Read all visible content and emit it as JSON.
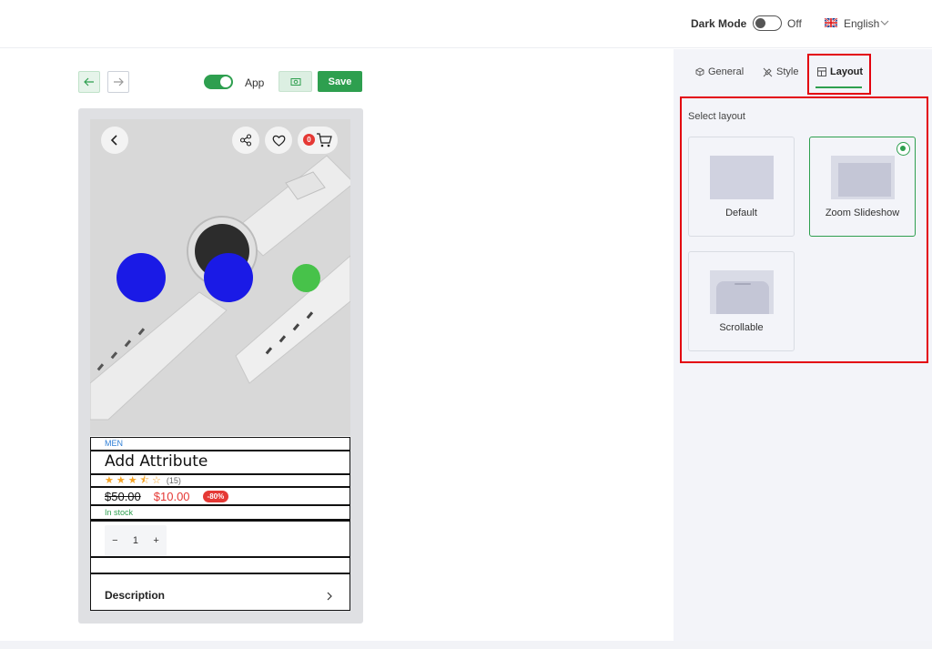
{
  "header": {
    "dark_mode_label": "Dark Mode",
    "dark_mode_state": "Off",
    "language": "English"
  },
  "toolbar": {
    "app_label": "App",
    "save_label": "Save"
  },
  "product": {
    "category": "MEN",
    "title": "Add Attribute",
    "rating_count": "(15)",
    "rating": 3.5,
    "old_price": "$50.00",
    "new_price": "$10.00",
    "discount": "-80%",
    "stock": "In stock",
    "qty_minus": "−",
    "qty_value": "1",
    "qty_plus": "+",
    "description_label": "Description",
    "cart_count": "0"
  },
  "panel": {
    "tabs": [
      {
        "label": "General",
        "icon": "cube-icon"
      },
      {
        "label": "Style",
        "icon": "brush-icon"
      },
      {
        "label": "Layout",
        "icon": "layout-icon"
      }
    ],
    "active_tab": "Layout",
    "section_title": "Select layout",
    "layouts": [
      {
        "label": "Default",
        "selected": false
      },
      {
        "label": "Zoom Slideshow",
        "selected": true
      },
      {
        "label": "Scrollable",
        "selected": false
      }
    ]
  },
  "colors": {
    "accent": "#2e9f4f",
    "highlight": "#e3000f",
    "price": "#e53935",
    "dot_blue": "#1a1ae6",
    "dot_green": "#47c24a"
  }
}
